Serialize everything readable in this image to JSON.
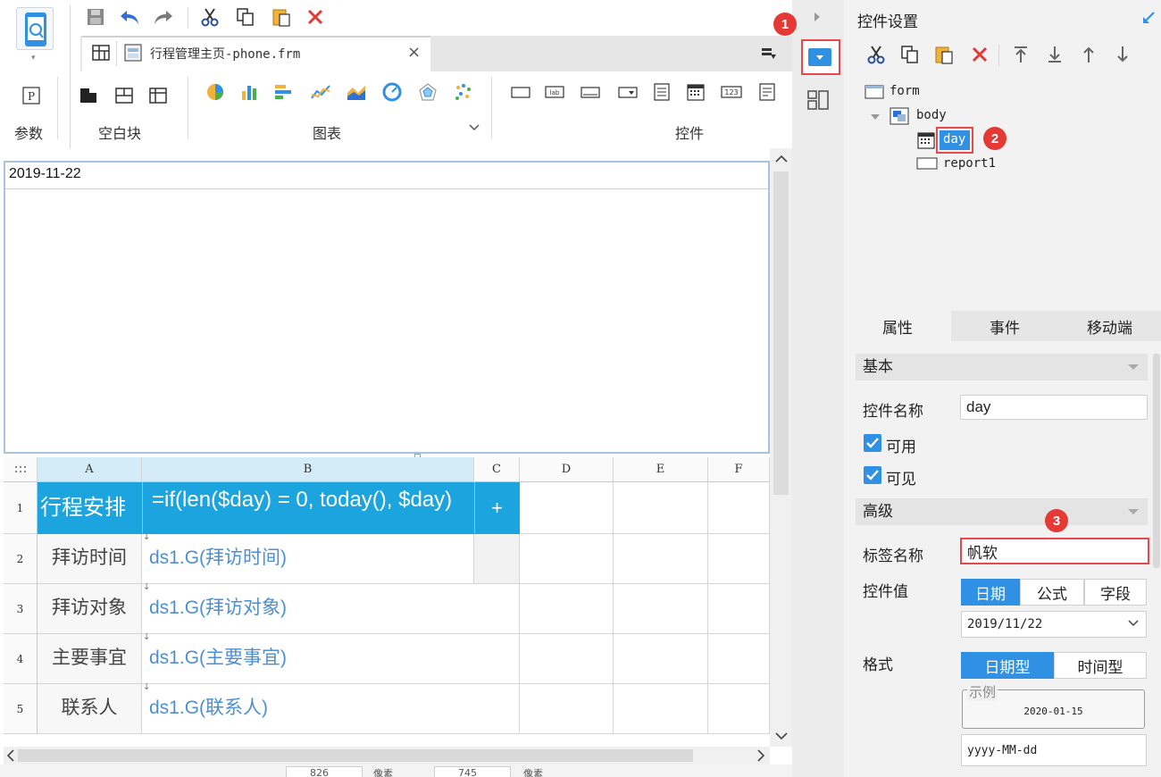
{
  "document": {
    "tab_title": "行程管理主页-phone.frm",
    "close_glyph": "×"
  },
  "toolbar": {
    "groups": {
      "params": "参数",
      "blank_block": "空白块",
      "chart": "图表",
      "widgets": "控件"
    },
    "param_icon_letter": "P",
    "widget_icon_labels": {
      "label": "lab",
      "number": "123"
    }
  },
  "parameter_panel": {
    "date_value": "2019-11-22"
  },
  "grid": {
    "columns": [
      "A",
      "B",
      "C",
      "D",
      "E",
      "F"
    ],
    "rows": [
      "1",
      "2",
      "3",
      "4",
      "5"
    ],
    "header_row": {
      "a": "行程安排",
      "b": "=if(len($day) = 0, today(), $day)",
      "c": "+"
    },
    "data_rows": [
      {
        "label": "拜访时间",
        "formula": "ds1.G(拜访时间)"
      },
      {
        "label": "拜访对象",
        "formula": "ds1.G(拜访对象)"
      },
      {
        "label": "主要事宜",
        "formula": "ds1.G(主要事宜)"
      },
      {
        "label": "联系人",
        "formula": "ds1.G(联系人)"
      }
    ]
  },
  "status_bar": {
    "width_value": "826",
    "unit1": "像素",
    "height_value": "745",
    "unit2": "像素"
  },
  "badges": [
    "1",
    "2",
    "3"
  ],
  "right_panel": {
    "title": "控件设置",
    "tree": {
      "form": "form",
      "body": "body",
      "day": "day",
      "report": "report1"
    },
    "tabs": [
      "属性",
      "事件",
      "移动端"
    ],
    "sections": {
      "basic": "基本",
      "advanced": "高级"
    },
    "properties": {
      "widget_name_label": "控件名称",
      "widget_name_value": "day",
      "enabled_label": "可用",
      "visible_label": "可见",
      "tag_name_label": "标签名称",
      "tag_name_value": "帆软",
      "widget_value_label": "控件值",
      "value_modes": [
        "日期",
        "公式",
        "字段"
      ],
      "date_value": "2019/11/22",
      "format_label": "格式",
      "format_modes": [
        "日期型",
        "时间型"
      ],
      "sample_label": "示例",
      "sample_value": "2020-01-15",
      "format_pattern": "yyyy-MM-dd"
    }
  },
  "colors": {
    "accent_blue": "#2f90e4",
    "cell_blue": "#1ba4de",
    "highlight_red": "#e8484b",
    "formula_blue": "#4d8fd0"
  }
}
